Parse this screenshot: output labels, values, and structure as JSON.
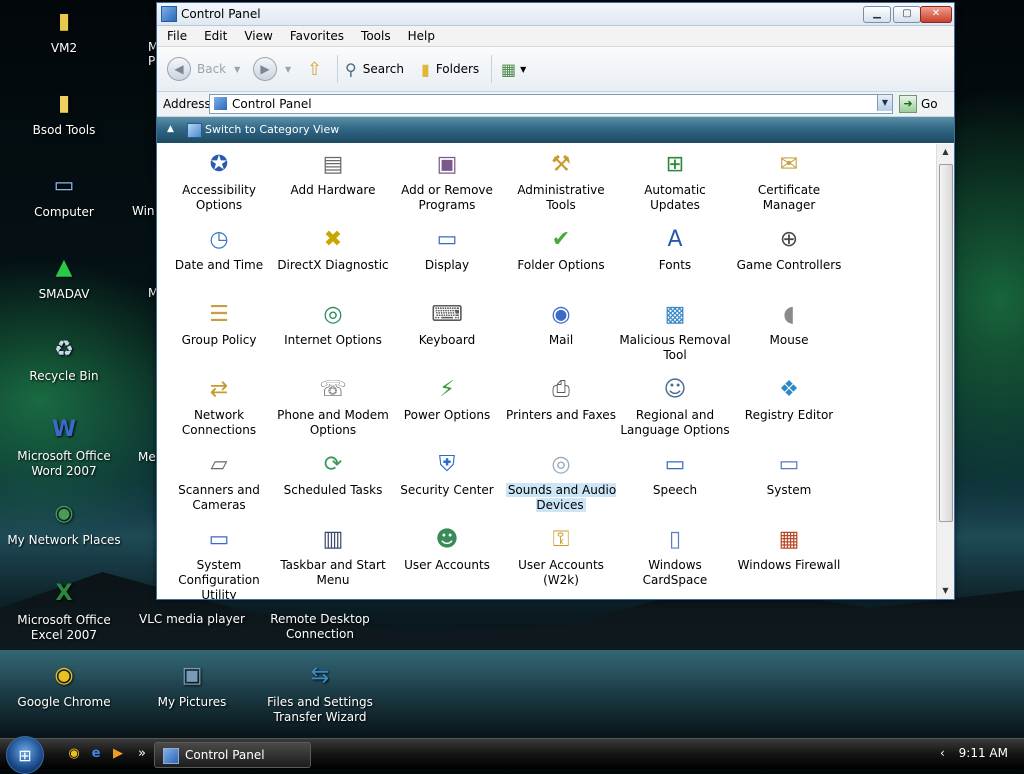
{
  "window": {
    "title": "Control Panel",
    "min_symbol": "▁",
    "max_symbol": "▢",
    "close_symbol": "✕",
    "menus": [
      "File",
      "Edit",
      "View",
      "Favorites",
      "Tools",
      "Help"
    ],
    "toolbar": {
      "back_label": "Back",
      "search_label": "Search",
      "folders_label": "Folders"
    },
    "address": {
      "label": "Address",
      "value": "Control Panel",
      "go_label": "Go"
    },
    "category_link": "Switch to Category View",
    "items": [
      {
        "label": "Accessibility Options",
        "icon": "accessibility-icon",
        "glyph": "✪",
        "color": "#2a5ab0"
      },
      {
        "label": "Add Hardware",
        "icon": "hardware-icon",
        "glyph": "▤",
        "color": "#6a6a6a"
      },
      {
        "label": "Add or Remove Programs",
        "icon": "programs-icon",
        "glyph": "▣",
        "color": "#7a5a8a"
      },
      {
        "label": "Administrative Tools",
        "icon": "admin-tools-icon",
        "glyph": "⚒",
        "color": "#c89a2a"
      },
      {
        "label": "Automatic Updates",
        "icon": "windows-update-icon",
        "glyph": "⊞",
        "color": "#2a8a3a"
      },
      {
        "label": "Certificate Manager",
        "icon": "certificate-icon",
        "glyph": "✉",
        "color": "#c8a040"
      },
      {
        "label": "Date and Time",
        "icon": "date-time-icon",
        "glyph": "◷",
        "color": "#3a7ac8"
      },
      {
        "label": "DirectX Diagnostic",
        "icon": "directx-icon",
        "glyph": "✖",
        "color": "#c8a800"
      },
      {
        "label": "Display",
        "icon": "display-icon",
        "glyph": "▭",
        "color": "#3a6ac8"
      },
      {
        "label": "Folder Options",
        "icon": "folder-options-icon",
        "glyph": "✔",
        "color": "#4aa83a"
      },
      {
        "label": "Fonts",
        "icon": "fonts-icon",
        "glyph": "A",
        "color": "#2a5ab0"
      },
      {
        "label": "Game Controllers",
        "icon": "game-controller-icon",
        "glyph": "⊕",
        "color": "#4a4a4a"
      },
      {
        "label": "Group Policy",
        "icon": "group-policy-icon",
        "glyph": "☰",
        "color": "#c8a040"
      },
      {
        "label": "Internet Options",
        "icon": "internet-options-icon",
        "glyph": "◎",
        "color": "#2a8a5a"
      },
      {
        "label": "Keyboard",
        "icon": "keyboard-icon",
        "glyph": "⌨",
        "color": "#5a5a5a"
      },
      {
        "label": "Mail",
        "icon": "mail-icon",
        "glyph": "◉",
        "color": "#3a6ac8"
      },
      {
        "label": "Malicious Removal Tool",
        "icon": "malicious-removal-icon",
        "glyph": "▩",
        "color": "#3a8ac8"
      },
      {
        "label": "Mouse",
        "icon": "mouse-icon",
        "glyph": "◖",
        "color": "#8a8a8a"
      },
      {
        "label": "Network Connections",
        "icon": "network-icon",
        "glyph": "⇄",
        "color": "#c89a2a"
      },
      {
        "label": "Phone and Modem Options",
        "icon": "phone-icon",
        "glyph": "☏",
        "color": "#6a6a6a"
      },
      {
        "label": "Power Options",
        "icon": "power-icon",
        "glyph": "⚡",
        "color": "#3a9a3a"
      },
      {
        "label": "Printers and Faxes",
        "icon": "printer-icon",
        "glyph": "⎙",
        "color": "#5a5a5a"
      },
      {
        "label": "Regional and Language Options",
        "icon": "regional-icon",
        "glyph": "☺",
        "color": "#4a6a9a"
      },
      {
        "label": "Registry Editor",
        "icon": "registry-icon",
        "glyph": "❖",
        "color": "#2a8ac8"
      },
      {
        "label": "Scanners and Cameras",
        "icon": "scanner-icon",
        "glyph": "▱",
        "color": "#6a6a6a"
      },
      {
        "label": "Scheduled Tasks",
        "icon": "scheduled-tasks-icon",
        "glyph": "⟳",
        "color": "#3a9a5a"
      },
      {
        "label": "Security Center",
        "icon": "security-shield-icon",
        "glyph": "⛨",
        "color": "#2a6ac8"
      },
      {
        "label": "Sounds and Audio Devices",
        "icon": "speaker-icon",
        "glyph": "◎",
        "color": "#9aaab8",
        "selected": true
      },
      {
        "label": "Speech",
        "icon": "speech-icon",
        "glyph": "▭",
        "color": "#3a6ac8"
      },
      {
        "label": "System",
        "icon": "system-icon",
        "glyph": "▭",
        "color": "#5a7ab8"
      },
      {
        "label": "System Configuration Utility",
        "icon": "system-config-icon",
        "glyph": "▭",
        "color": "#3a6ac8"
      },
      {
        "label": "Taskbar and Start Menu",
        "icon": "taskbar-icon",
        "glyph": "▥",
        "color": "#3a4a6a"
      },
      {
        "label": "User Accounts",
        "icon": "user-accounts-icon",
        "glyph": "☻",
        "color": "#3a8a5a"
      },
      {
        "label": "User Accounts (W2k)",
        "icon": "user-lock-icon",
        "glyph": "⚿",
        "color": "#c89a2a"
      },
      {
        "label": "Windows CardSpace",
        "icon": "cardspace-icon",
        "glyph": "▯",
        "color": "#5a7ac8"
      },
      {
        "label": "Windows Firewall",
        "icon": "firewall-icon",
        "glyph": "▦",
        "color": "#b84a2a"
      }
    ]
  },
  "desktop": {
    "icons": [
      {
        "label": "VM2",
        "icon": "zip-folder-icon",
        "glyph": "▮",
        "color": "#e8c84a"
      },
      {
        "label": "Bsod Tools",
        "icon": "folder-icon",
        "glyph": "▮",
        "color": "#f0d060"
      },
      {
        "label": "Computer",
        "icon": "computer-icon",
        "glyph": "▭",
        "color": "#8ab8e8"
      },
      {
        "label": "SMADAV",
        "icon": "smadav-icon",
        "glyph": "▲",
        "color": "#2ac84a"
      },
      {
        "label": "Recycle Bin",
        "icon": "recycle-bin-icon",
        "glyph": "♻",
        "color": "#c8d8e8"
      },
      {
        "label": "Microsoft Office Word 2007",
        "icon": "word-icon",
        "glyph": "W",
        "color": "#3a6ac8"
      },
      {
        "label": "My Network Places",
        "icon": "network-places-icon",
        "glyph": "◉",
        "color": "#4a9a5a"
      },
      {
        "label": "Microsoft Office Excel 2007",
        "icon": "excel-icon",
        "glyph": "X",
        "color": "#2a8a3a"
      },
      {
        "label": "Google Chrome",
        "icon": "chrome-icon",
        "glyph": "◉",
        "color": "#e8c020"
      },
      {
        "label": "VLC media player",
        "icon": "vlc-icon",
        "glyph": "▲",
        "color": "#f08020"
      },
      {
        "label": "Remote Desktop Connection",
        "icon": "remote-desktop-icon",
        "glyph": "▭",
        "color": "#8ab8e8"
      },
      {
        "label": "My Pictures",
        "icon": "pictures-icon",
        "glyph": "▣",
        "color": "#7a9ab8"
      },
      {
        "label": "Files and Settings Transfer Wizard",
        "icon": "transfer-wizard-icon",
        "glyph": "⇆",
        "color": "#3a8ac8"
      }
    ],
    "partial_labels": [
      "M",
      "P",
      "Win",
      "M",
      "Me"
    ]
  },
  "taskbar": {
    "start_glyph": "⊞",
    "quicklaunch": [
      {
        "icon": "chrome-icon",
        "glyph": "◉",
        "color": "#e8c020"
      },
      {
        "icon": "ie-icon",
        "glyph": "e",
        "color": "#3a8ae8"
      },
      {
        "icon": "media-player-icon",
        "glyph": "▶",
        "color": "#f0a020"
      }
    ],
    "overflow": "»",
    "task_label": "Control Panel",
    "tray_chevron": "‹",
    "clock": "9:11 AM"
  }
}
